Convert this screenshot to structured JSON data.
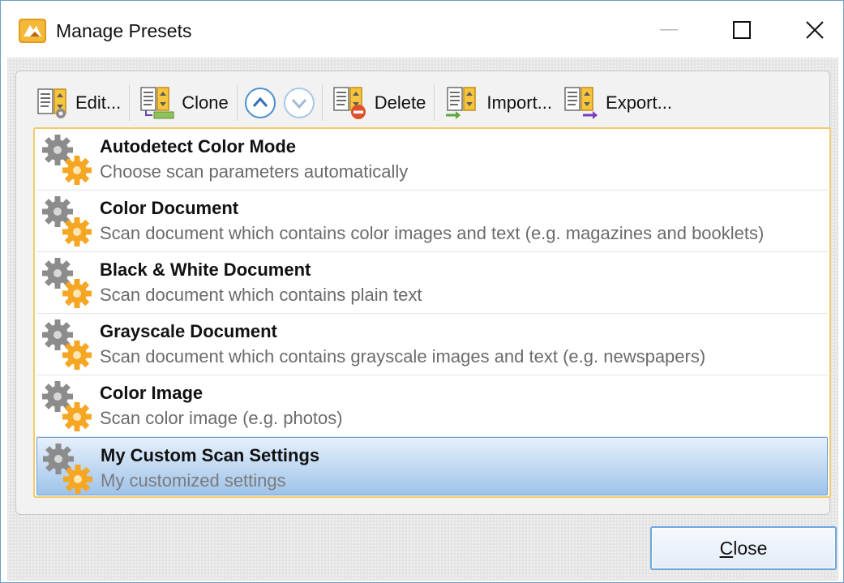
{
  "window": {
    "title": "Manage Presets",
    "icon": "pdf-xchange-app-icon",
    "controls": [
      "minimize-icon",
      "maximize-icon",
      "close-icon"
    ]
  },
  "toolbar": {
    "edit_label": "Edit...",
    "clone_label": "Clone",
    "move_up_icon": "chevron-up-circle-icon",
    "move_down_icon": "chevron-down-circle-icon",
    "delete_label": "Delete",
    "import_label": "Import...",
    "export_label": "Export..."
  },
  "presets": [
    {
      "name": "Autodetect Color Mode",
      "description": "Choose scan parameters automatically",
      "selected": false
    },
    {
      "name": "Color Document",
      "description": "Scan document which contains color images and text (e.g. magazines and booklets)",
      "selected": false
    },
    {
      "name": "Black & White Document",
      "description": "Scan document which contains plain text",
      "selected": false
    },
    {
      "name": "Grayscale Document",
      "description": "Scan document which contains grayscale images and text (e.g. newspapers)",
      "selected": false
    },
    {
      "name": "Color Image",
      "description": "Scan color image (e.g. photos)",
      "selected": false
    },
    {
      "name": "My Custom Scan Settings",
      "description": "My customized settings",
      "selected": true
    }
  ],
  "footer": {
    "close_mnemonic": "C",
    "close_rest": "lose"
  },
  "colors": {
    "accent_border": "#f3cb6a",
    "selection": "#9ec3ea",
    "icon_gold": "#f5a623",
    "icon_gray": "#8a8a8a"
  }
}
